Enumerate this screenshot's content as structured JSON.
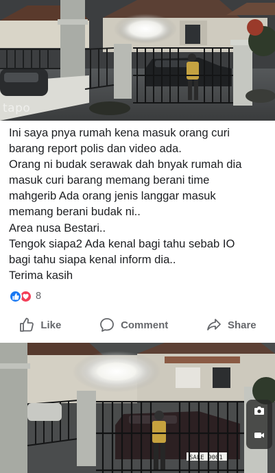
{
  "watermark": "tapo",
  "post": {
    "lines": [
      "Ini saya pnya rumah kena masuk orang curi",
      "barang report polis dan video ada.",
      "Orang ni budak serawak dah bnyak rumah dia",
      "masuk curi barang memang berani time",
      "mahgerib Ada orang jenis langgar masuk",
      "memang berani budak ni..",
      "Area nusa Bestari..",
      "Tengok siapa2 Ada kenal bagi tahu sebab IO",
      "bagi tahu siapa kenal inform dia..",
      "Terima kasih"
    ]
  },
  "reactions": {
    "icons": [
      "like-icon",
      "love-icon"
    ],
    "count": "8",
    "colors": {
      "like": "#1877f2",
      "love": "#f33e58"
    }
  },
  "actions": {
    "like_label": "Like",
    "comment_label": "Comment",
    "share_label": "Share"
  },
  "side_tools": {
    "icons": [
      "camera-icon",
      "video-icon"
    ]
  },
  "bottom_image": {
    "plate_text": "SALE 9001"
  }
}
